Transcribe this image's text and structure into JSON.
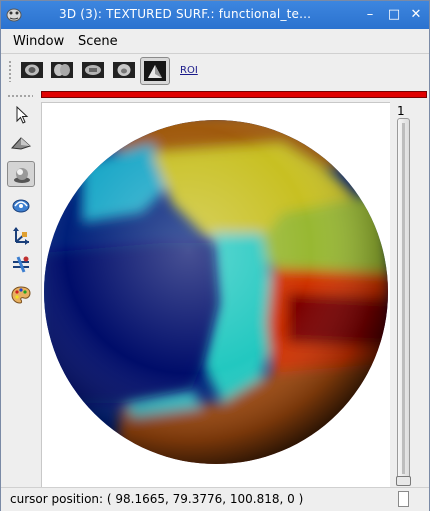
{
  "window": {
    "title": "3D (3): TEXTURED SURF.: functional_te...",
    "minimize_glyph": "–",
    "maximize_glyph": "□",
    "close_glyph": "✕"
  },
  "menubar": {
    "items": [
      "Window",
      "Scene"
    ]
  },
  "toolbar": {
    "buttons": [
      {
        "name": "brain-view-1-icon"
      },
      {
        "name": "brain-view-2-icon"
      },
      {
        "name": "brain-view-3-icon"
      },
      {
        "name": "brain-view-4-icon"
      },
      {
        "name": "surface-view-icon",
        "active": true
      }
    ],
    "roi_label": "ROI"
  },
  "tools": [
    {
      "name": "arrow-select-icon"
    },
    {
      "name": "plane-tool-icon"
    },
    {
      "name": "sphere-navigate-icon",
      "active": true
    },
    {
      "name": "view-rotate-icon"
    },
    {
      "name": "axes-tool-icon"
    },
    {
      "name": "cut-plane-icon"
    },
    {
      "name": "palette-icon"
    }
  ],
  "colors": {
    "accent": "#2b72cf",
    "progress_bar": "#e00000"
  },
  "slider": {
    "label": "1"
  },
  "status": {
    "text": "cursor position: ( 98.1665, 79.3776, 100.818, 0 )"
  }
}
